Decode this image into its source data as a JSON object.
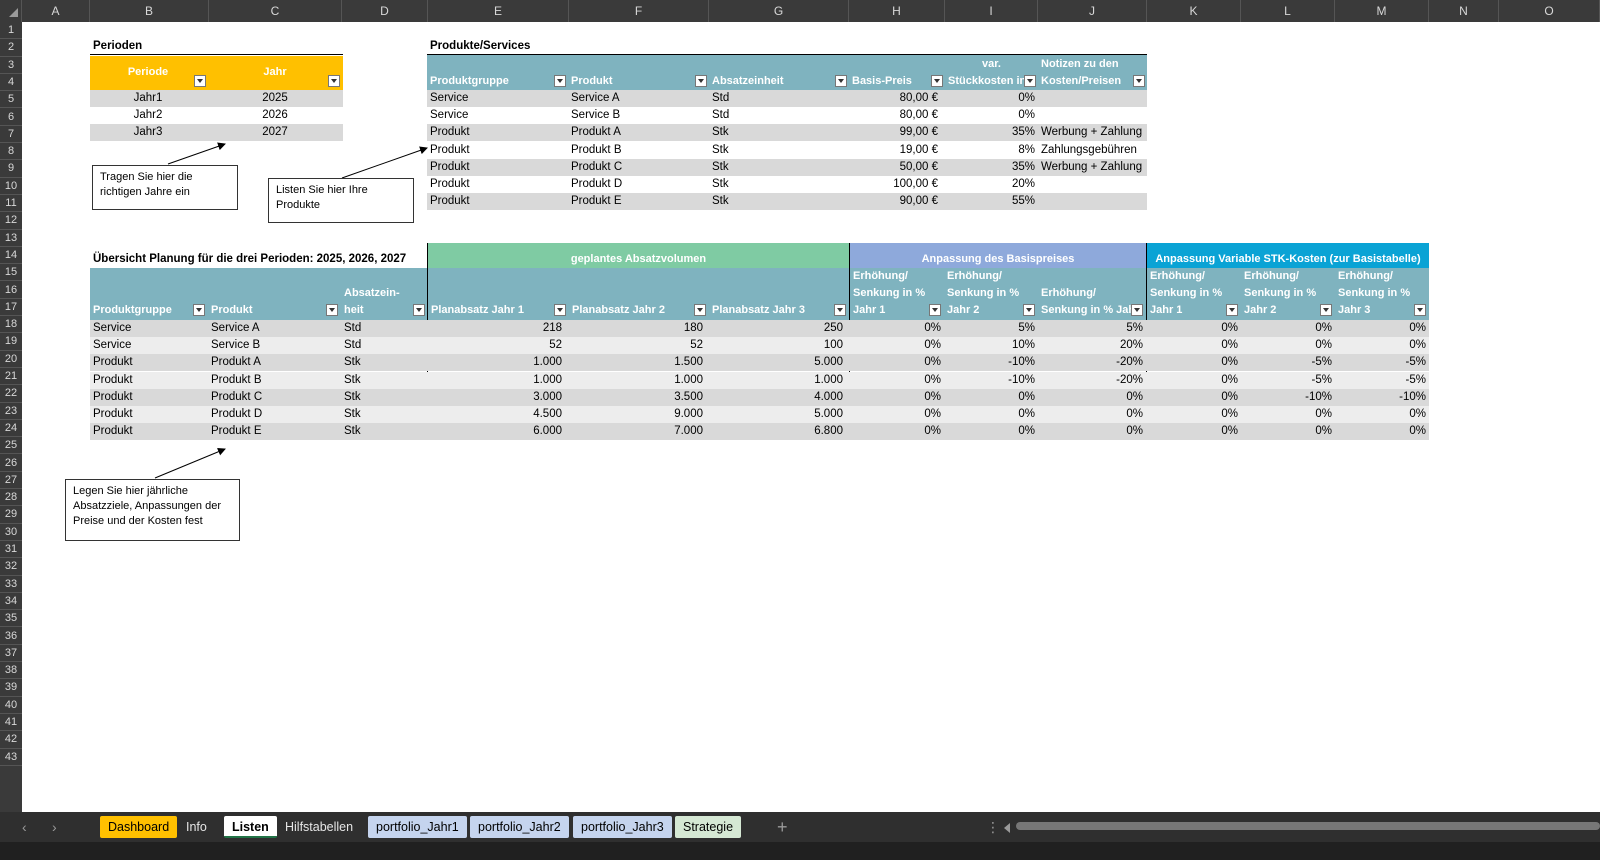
{
  "columns": [
    "A",
    "B",
    "C",
    "D",
    "E",
    "F",
    "G",
    "H",
    "I",
    "J",
    "K",
    "L",
    "M",
    "N",
    "O"
  ],
  "rows": [
    "1",
    "2",
    "3",
    "4",
    "5",
    "6",
    "7",
    "8",
    "9",
    "10",
    "11",
    "12",
    "13",
    "14",
    "15",
    "16",
    "17",
    "18",
    "19",
    "20",
    "21",
    "22",
    "23",
    "24",
    "25",
    "26",
    "27",
    "28",
    "29",
    "30",
    "31",
    "32",
    "33",
    "34",
    "35",
    "36",
    "37",
    "38",
    "39",
    "40",
    "41",
    "42",
    "43"
  ],
  "perioden": {
    "title": "Perioden",
    "headers": [
      "Periode",
      "Jahr"
    ],
    "rows": [
      [
        "Jahr1",
        "2025"
      ],
      [
        "Jahr2",
        "2026"
      ],
      [
        "Jahr3",
        "2027"
      ]
    ]
  },
  "produkte": {
    "title": "Produkte/Services",
    "headers": [
      "Produktgruppe",
      "Produkt",
      "Absatzeinheit",
      "Basis-Preis",
      "var. Stückkosten in",
      "Notizen zu den Kosten/Preisen"
    ],
    "header_line1": [
      "",
      "",
      "",
      "",
      "var.",
      "Notizen zu den"
    ],
    "header_line2": [
      "Produktgruppe",
      "Produkt",
      "Absatzeinheit",
      "Basis-Preis",
      "Stückkosten in",
      "Kosten/Preisen"
    ],
    "rows": [
      [
        "Service",
        "Service A",
        "Std",
        "80,00 €",
        "0%",
        ""
      ],
      [
        "Service",
        "Service B",
        "Std",
        "80,00 €",
        "0%",
        ""
      ],
      [
        "Produkt",
        "Produkt A",
        "Stk",
        "99,00 €",
        "35%",
        "Werbung + Zahlung"
      ],
      [
        "Produkt",
        "Produkt B",
        "Stk",
        "19,00 €",
        "8%",
        "Zahlungsgebühren"
      ],
      [
        "Produkt",
        "Produkt C",
        "Stk",
        "50,00 €",
        "35%",
        "Werbung + Zahlung"
      ],
      [
        "Produkt",
        "Produkt D",
        "Stk",
        "100,00 €",
        "20%",
        ""
      ],
      [
        "Produkt",
        "Produkt E",
        "Stk",
        "90,00 €",
        "55%",
        ""
      ]
    ]
  },
  "notes": {
    "jahre": [
      "Tragen Sie hier die",
      "richtigen Jahre ein"
    ],
    "produkte": [
      "Listen Sie hier Ihre",
      "Produkte"
    ],
    "planung": [
      "Legen Sie hier jährliche",
      "Absatzziele, Anpassungen der",
      "Preise und der Kosten fest"
    ]
  },
  "planung": {
    "title": "Übersicht Planung für die drei Perioden: 2025, 2026, 2027",
    "group_absatz": "geplantes Absatzvolumen",
    "group_preis": "Anpassung des Basispreises",
    "group_kosten": "Anpassung Variable STK-Kosten (zur Basistabelle)",
    "headers": {
      "produktgruppe": "Produktgruppe",
      "produkt": "Produkt",
      "absatz_line1": "Absatzein-",
      "absatz_line2": "heit",
      "plan1": "Planabsatz Jahr 1",
      "plan2": "Planabsatz Jahr 2",
      "plan3": "Planabsatz Jahr 3",
      "erh": "Erhöhung/",
      "senk": "Senkung in %",
      "senk_j3": "Senkung in % Jah",
      "jahr1": "Jahr 1",
      "jahr2": "Jahr 2",
      "jahr3": "Jahr 3"
    },
    "rows": [
      [
        "Service",
        "Service A",
        "Std",
        "218",
        "180",
        "250",
        "0%",
        "5%",
        "5%",
        "0%",
        "0%",
        "0%"
      ],
      [
        "Service",
        "Service B",
        "Std",
        "52",
        "52",
        "100",
        "0%",
        "10%",
        "20%",
        "0%",
        "0%",
        "0%"
      ],
      [
        "Produkt",
        "Produkt A",
        "Stk",
        "1.000",
        "1.500",
        "5.000",
        "0%",
        "-10%",
        "-20%",
        "0%",
        "-5%",
        "-5%"
      ],
      [
        "Produkt",
        "Produkt B",
        "Stk",
        "1.000",
        "1.000",
        "1.000",
        "0%",
        "-10%",
        "-20%",
        "0%",
        "-5%",
        "-5%"
      ],
      [
        "Produkt",
        "Produkt C",
        "Stk",
        "3.000",
        "3.500",
        "4.000",
        "0%",
        "0%",
        "0%",
        "0%",
        "-10%",
        "-10%"
      ],
      [
        "Produkt",
        "Produkt D",
        "Stk",
        "4.500",
        "9.000",
        "5.000",
        "0%",
        "0%",
        "0%",
        "0%",
        "0%",
        "0%"
      ],
      [
        "Produkt",
        "Produkt E",
        "Stk",
        "6.000",
        "7.000",
        "6.800",
        "0%",
        "0%",
        "0%",
        "0%",
        "0%",
        "0%"
      ]
    ]
  },
  "tabs": [
    {
      "label": "Dashboard",
      "active": false
    },
    {
      "label": "Info",
      "active": false
    },
    {
      "label": "Listen",
      "active": true
    },
    {
      "label": "Hilfstabellen",
      "active": false
    },
    {
      "label": "portfolio_Jahr1",
      "active": false
    },
    {
      "label": "portfolio_Jahr2",
      "active": false
    },
    {
      "label": "portfolio_Jahr3",
      "active": false
    },
    {
      "label": "Strategie",
      "active": false
    }
  ],
  "icons": {
    "add_sheet": "plus-icon",
    "prev": "chevron-left-icon",
    "next": "chevron-right-icon",
    "more": "vertical-dots-icon"
  },
  "colors": {
    "perioden_header": "#FFC000",
    "produkte_header": "#7FB3BF",
    "absatz_group": "#7FCBA3",
    "preis_group": "#8EA9DB",
    "kosten_group": "#0AA3D5",
    "band": "#D9D9D9",
    "tab_dashboard": "#FFC000",
    "tab_portfolio": "#C5D4EE",
    "tab_strategie": "#D5E8D4"
  }
}
